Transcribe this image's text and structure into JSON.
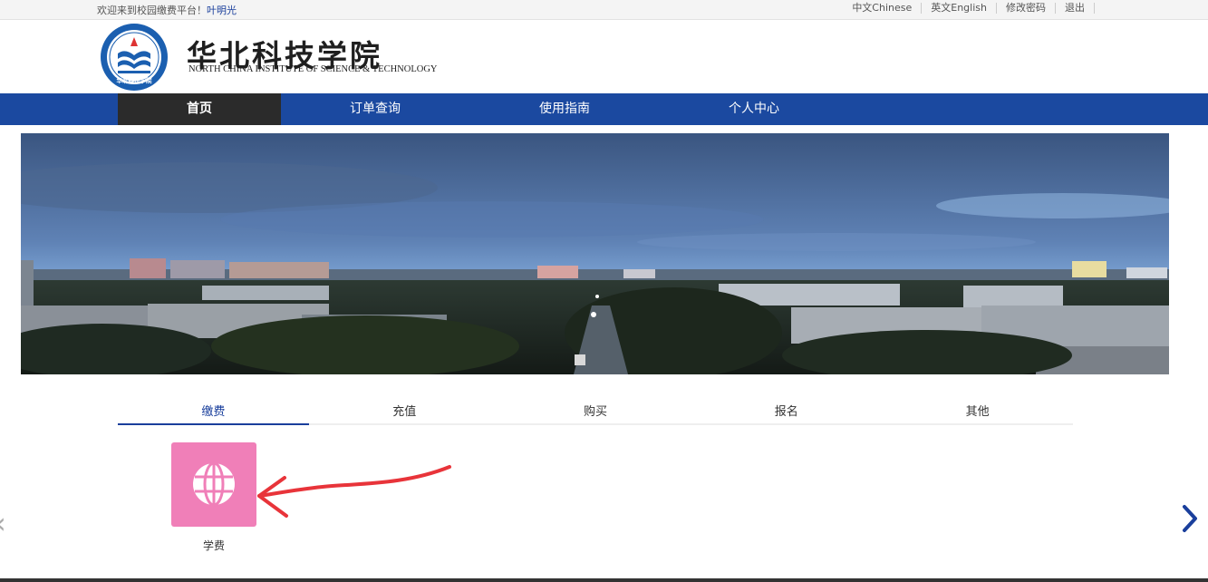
{
  "topbar": {
    "welcome": "欢迎来到校园缴费平台！",
    "username": "叶明光",
    "links": [
      "中文Chinese",
      "英文English",
      "修改密码",
      "退出"
    ]
  },
  "header": {
    "logo_cn": "华北科技学院",
    "logo_en": "NORTH CHINA INSTITUTE OF SCIENCE & TECHNOLOGY",
    "emblem_text": "华北科技学院"
  },
  "nav": {
    "items": [
      "首页",
      "订单查询",
      "使用指南",
      "个人中心"
    ],
    "active_index": 0
  },
  "tabs": {
    "items": [
      "缴费",
      "充值",
      "购买",
      "报名",
      "其他"
    ],
    "active_index": 0
  },
  "services": {
    "items": [
      {
        "label": "学费",
        "icon": "globe-icon",
        "color": "#f07fb8"
      }
    ]
  },
  "colors": {
    "nav_bg": "#1b49a0",
    "nav_active": "#2b2b2b",
    "accent": "#1a3f9c",
    "annotation_arrow": "#e8343a"
  }
}
